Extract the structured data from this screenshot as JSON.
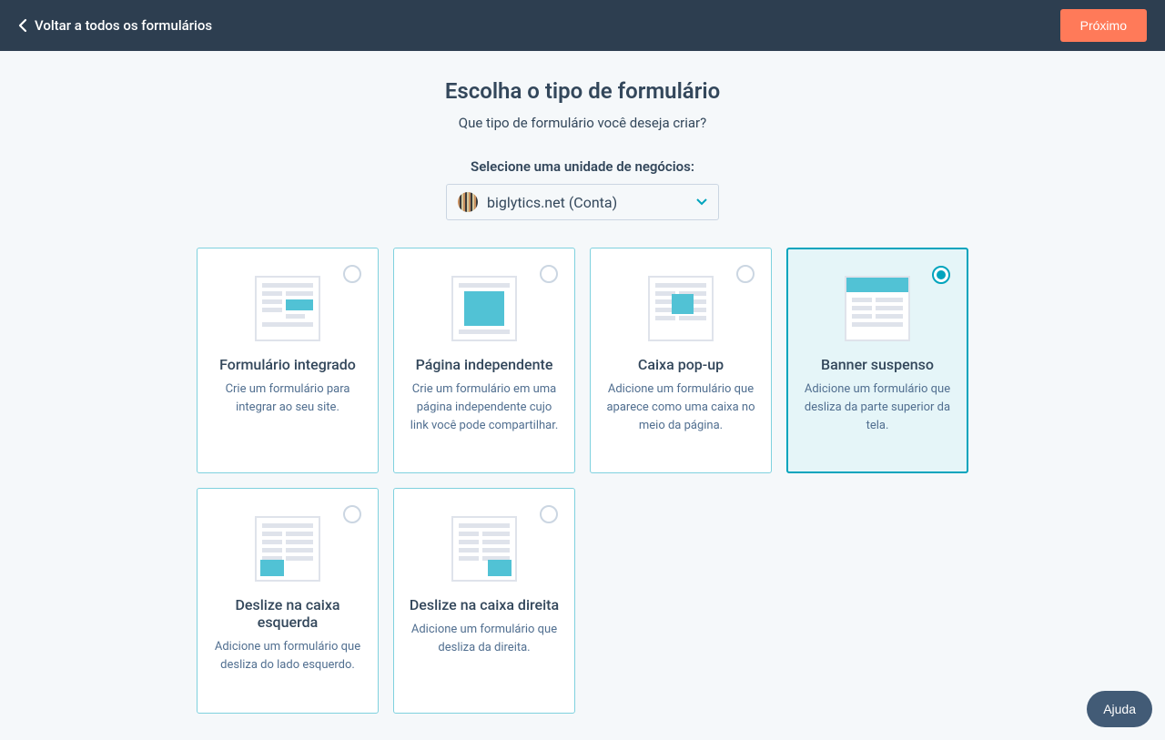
{
  "header": {
    "back_label": "Voltar a todos os formulários",
    "next_label": "Próximo"
  },
  "page": {
    "title": "Escolha o tipo de formulário",
    "subtitle": "Que tipo de formulário você deseja criar?",
    "biz_label": "Selecione uma unidade de negócios:",
    "dropdown_value": "biglytics.net (Conta)"
  },
  "cards": [
    {
      "title": "Formulário integrado",
      "desc": "Crie um formulário para integrar ao seu site.",
      "selected": false
    },
    {
      "title": "Página independente",
      "desc": "Crie um formulário em uma página independente cujo link você pode compartilhar.",
      "selected": false
    },
    {
      "title": "Caixa pop-up",
      "desc": "Adicione um formulário que aparece como uma caixa no meio da página.",
      "selected": false
    },
    {
      "title": "Banner suspenso",
      "desc": "Adicione um formulário que desliza da parte superior da tela.",
      "selected": true
    },
    {
      "title": "Deslize na caixa esquerda",
      "desc": "Adicione um formulário que desliza do lado esquerdo.",
      "selected": false
    },
    {
      "title": "Deslize na caixa direita",
      "desc": "Adicione um formulário que desliza da direita.",
      "selected": false
    }
  ],
  "help": {
    "label": "Ajuda"
  }
}
